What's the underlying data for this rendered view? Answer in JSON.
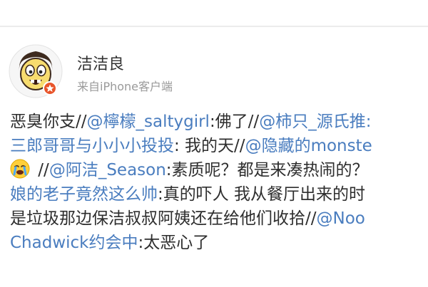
{
  "post": {
    "author": "洁洁良",
    "source": "来自iPhone客户端",
    "lines": [
      [
        {
          "text": "恶臭你支//",
          "mention": false
        },
        {
          "text": "@檸檬_saltygirl",
          "mention": true
        },
        {
          "text": ":佛了//",
          "mention": false
        },
        {
          "text": "@柿只_源氏推:",
          "mention": true
        }
      ],
      [
        {
          "text": "三郎哥哥与小小小投投",
          "mention": true
        },
        {
          "text": ": 我的天//",
          "mention": false
        },
        {
          "text": "@隐藏的monste",
          "mention": true
        }
      ],
      [
        {
          "text": " //",
          "mention": false
        },
        {
          "text": "@阿洁_Season",
          "mention": true
        },
        {
          "text": ":素质呢？都是来凑热闹的？",
          "mention": false
        }
      ],
      [
        {
          "text": "娘的老子竟然这么帅",
          "mention": true
        },
        {
          "text": ":真的吓人 我从餐厅出来的时",
          "mention": false
        }
      ],
      [
        {
          "text": "是垃圾那边保洁叔叔阿姨还在给他们收拾//",
          "mention": false
        },
        {
          "text": "@Noo",
          "mention": true
        }
      ],
      [
        {
          "text": "Chadwick约会中",
          "mention": true
        },
        {
          "text": ":太恶心了",
          "mention": false
        }
      ]
    ],
    "emoji_icon": "crying-face-emoji-icon"
  },
  "colors": {
    "mention": "#4a7dbf",
    "text": "#2e2e2e",
    "meta": "#9a9a9a",
    "badge": "#e8542a"
  }
}
